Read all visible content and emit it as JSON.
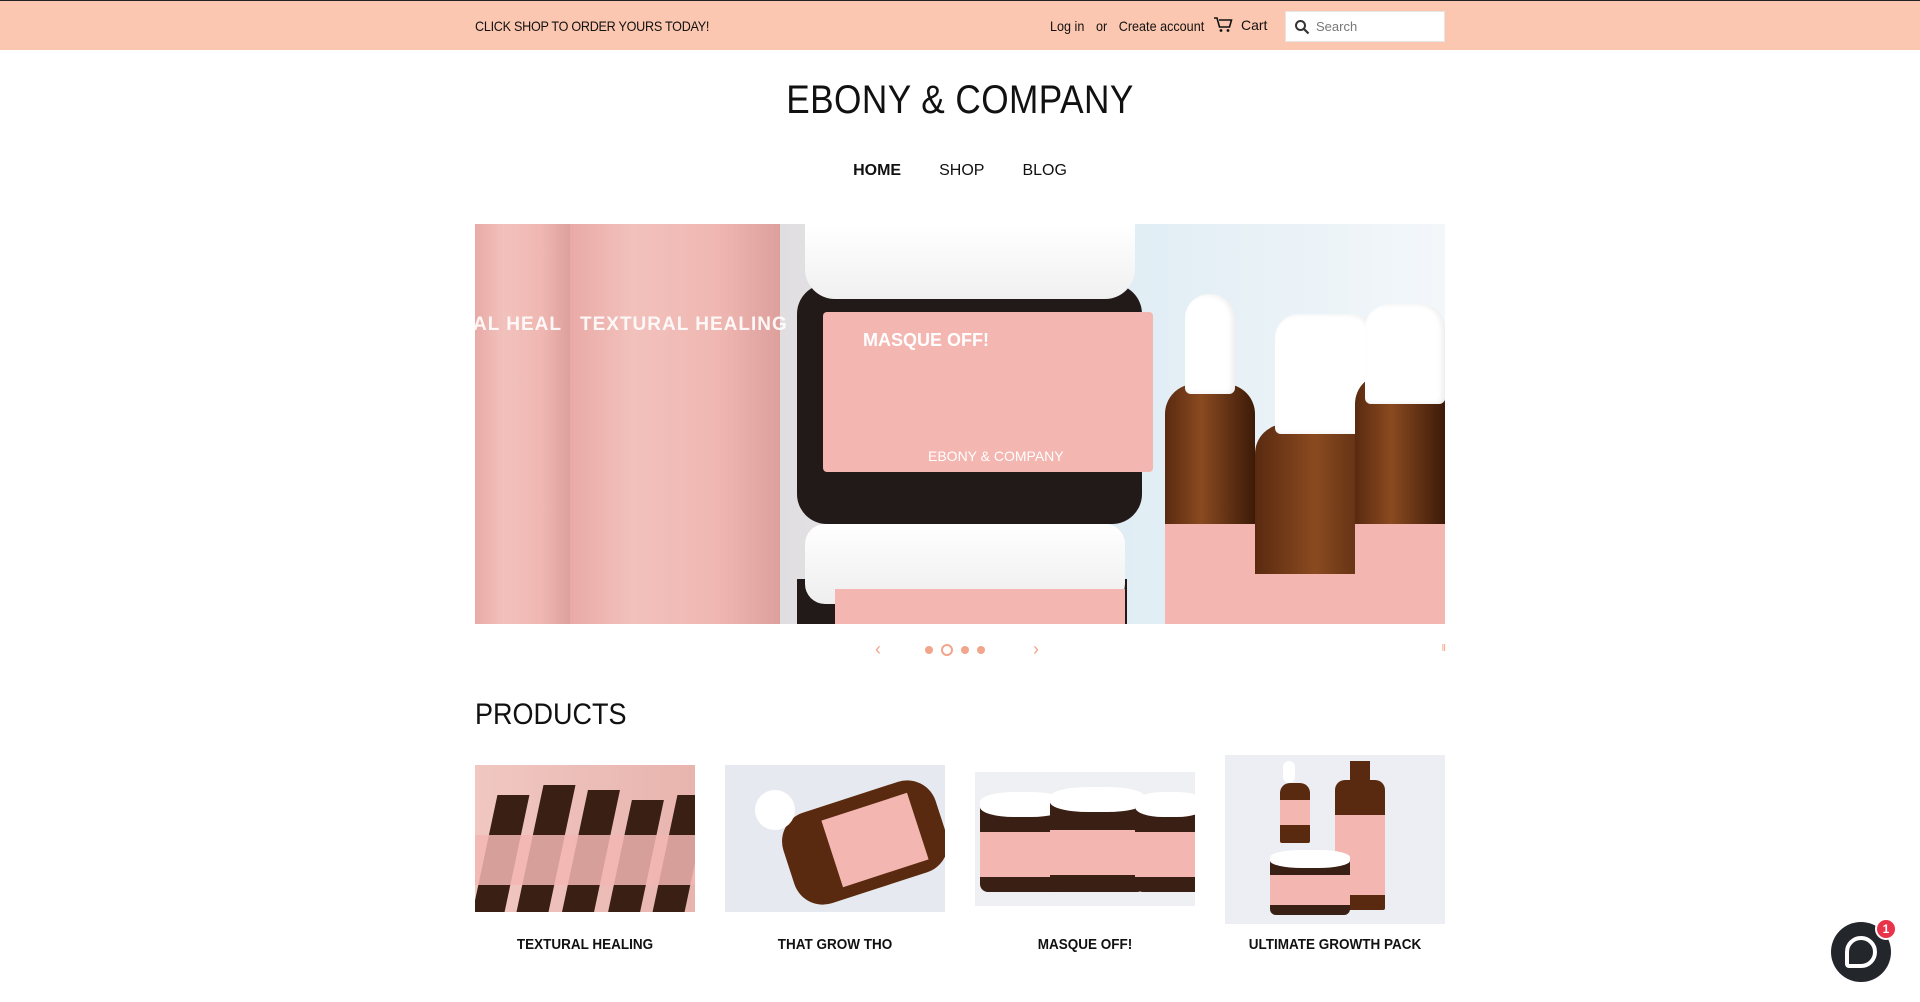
{
  "topbar": {
    "promo": "CLICK SHOP TO ORDER YOURS TODAY!",
    "login": "Log in",
    "or": "or",
    "create_account": "Create account",
    "cart": "Cart",
    "search_placeholder": "Search"
  },
  "header": {
    "logo": "EBONY & COMPANY"
  },
  "nav": {
    "items": [
      {
        "label": "HOME"
      },
      {
        "label": "SHOP"
      },
      {
        "label": "BLOG"
      }
    ]
  },
  "hero": {
    "tube_text": "TEXTURAL HEALING",
    "tube_text_partial": "AL HEAL",
    "jar_label": "MASQUE OFF!",
    "jar_brand": "EBONY & COMPANY",
    "slides_total": 4,
    "active_slide": 2
  },
  "slider": {
    "prev": "‹",
    "next": "›",
    "pause": "II"
  },
  "products": {
    "title": "PRODUCTS",
    "items": [
      {
        "name": "TEXTURAL HEALING"
      },
      {
        "name": "THAT GROW THO"
      },
      {
        "name": "MASQUE OFF!"
      },
      {
        "name": "ULTIMATE GROWTH PACK"
      }
    ]
  },
  "chat": {
    "badge_count": "1"
  },
  "colors": {
    "topbar_bg": "#fcc7b0",
    "accent": "#f2a58b",
    "label_pink": "#f3b6b1",
    "badge": "#e8334a"
  }
}
